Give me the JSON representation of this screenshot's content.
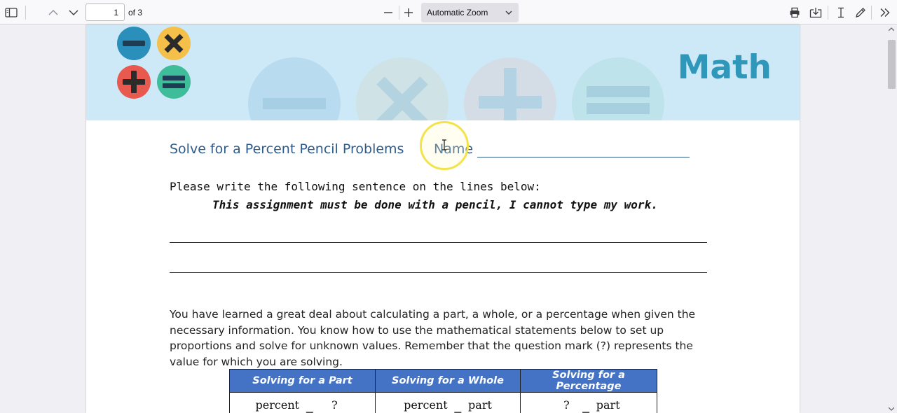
{
  "toolbar": {
    "page_number": "1",
    "page_count": "of 3",
    "zoom": "Automatic Zoom",
    "icons": [
      "sidebar-toggle-icon",
      "previous-page-icon",
      "next-page-icon",
      "zoom-out-icon",
      "zoom-in-icon",
      "chevron-down-icon",
      "print-icon",
      "save-download-icon",
      "text-cursor-icon",
      "draw-pen-icon",
      "more-tools-icon"
    ]
  },
  "banner": {
    "title": "Math",
    "colors": {
      "background": "#cde9f7",
      "minus": "#2a8fba",
      "times": "#f5c04a",
      "plus": "#e85a4f",
      "equals": "#3fbc9a",
      "title": "#2f97ba"
    }
  },
  "document": {
    "heading": "Solve for a Percent Pencil Problems",
    "name_label": "Name",
    "instruction": "Please write the following sentence on the lines below:",
    "sentence": "This assignment must be done with a pencil, I cannot type my work.",
    "paragraph": "You have learned a great deal about calculating a part, a whole, or a percentage when given the necessary information. You know how to use the mathematical statements below to set up proportions and solve for unknown values. Remember that the question mark (?) represents the value for which you are solving."
  },
  "table": {
    "headers": [
      "Solving for a Part",
      "Solving for a Whole",
      "Solving for a Percentage"
    ],
    "cells": [
      {
        "left": "percent",
        "right": "?"
      },
      {
        "left": "percent",
        "right": "part"
      },
      {
        "left": "?",
        "right": "part"
      }
    ],
    "header_color": "#4472c4"
  }
}
